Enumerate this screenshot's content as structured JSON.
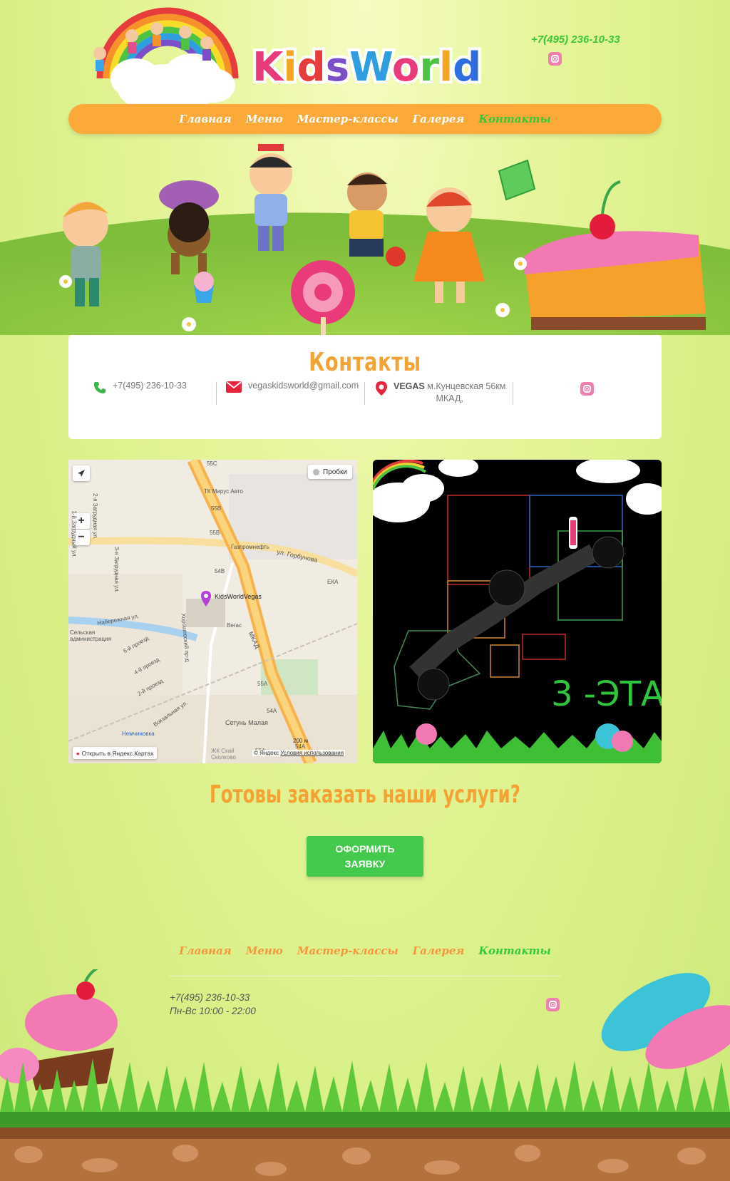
{
  "header": {
    "logo": "KidsWorld",
    "phone": "+7(495) 236-10-33",
    "instagram_icon": "instagram-icon"
  },
  "nav": {
    "items": [
      {
        "label": "Главная",
        "active": false
      },
      {
        "label": "Меню",
        "active": false
      },
      {
        "label": "Мастер-классы",
        "active": false
      },
      {
        "label": "Галерея",
        "active": false
      },
      {
        "label": "Контакты",
        "active": true
      }
    ]
  },
  "contacts": {
    "title": "Контакты",
    "phone": "+7(495) 236-10-33",
    "email": "vegaskidsworld@gmail.com",
    "address_bold": "VEGAS",
    "address_rest": "м.Кунцевская 56км",
    "address_line2": "МКАД,",
    "colors": {
      "phone_icon": "#3ab54a",
      "mail_icon": "#e6243b",
      "pin_icon": "#e6243b"
    }
  },
  "map": {
    "traffic_button": "Пробки",
    "zoom_in": "+",
    "zoom_out": "−",
    "open_in_yandex": "Открыть в Яндекс.Картах",
    "scale": "200 м",
    "copyright": "© Яндекс",
    "terms": "Условия использования",
    "marker_label": "KidsWorldVegas",
    "labels": {
      "mirus": "ТК Мирус Авто",
      "gazprom": "Газпромнефть",
      "gorbunova": "ул. Горбунова",
      "eka": "ЕКА",
      "vegas": "Вегас",
      "mkad": "МКАД",
      "admin": "Сельская администрация",
      "nemchinovka": "Немчиновка",
      "setun": "Сетунь Малая",
      "skolkovo": "ЖК Скай Сколково",
      "naberezhnaya": "Набережная ул.",
      "prosek6": "6-й проезд",
      "prosek4": "4-й проезд",
      "prosek2": "2-й проезд",
      "vokzalnaya": "Вокзальная ул.",
      "horoshevsky": "Хорошевский пр-д",
      "zagrudnaya1": "1-й Загрудный ул.",
      "zagrudnaya2": "2-я Загрудная ул.",
      "zagrudnaya3": "3-я Загрудная ул.",
      "r55c": "55С",
      "r55b": "55В",
      "r55b2": "55В",
      "r54b": "54В",
      "r55a": "55А",
      "r54a": "54А",
      "r54a2": "54А",
      "r55a2": "55А"
    }
  },
  "floor_plan": {
    "floor_label": "3 -ЭТАЖ"
  },
  "cta": {
    "title": "Готовы заказать наши услуги?",
    "button_line1": "ОФОРМИТЬ",
    "button_line2": "ЗАЯВКУ"
  },
  "footer": {
    "nav": [
      {
        "label": "Главная",
        "active": false
      },
      {
        "label": "Меню",
        "active": false
      },
      {
        "label": "Мастер-классы",
        "active": false
      },
      {
        "label": "Галерея",
        "active": false
      },
      {
        "label": "Контакты",
        "active": true
      }
    ],
    "phone": "+7(495) 236-10-33",
    "hours": "Пн-Вс 10:00 - 22:00"
  }
}
